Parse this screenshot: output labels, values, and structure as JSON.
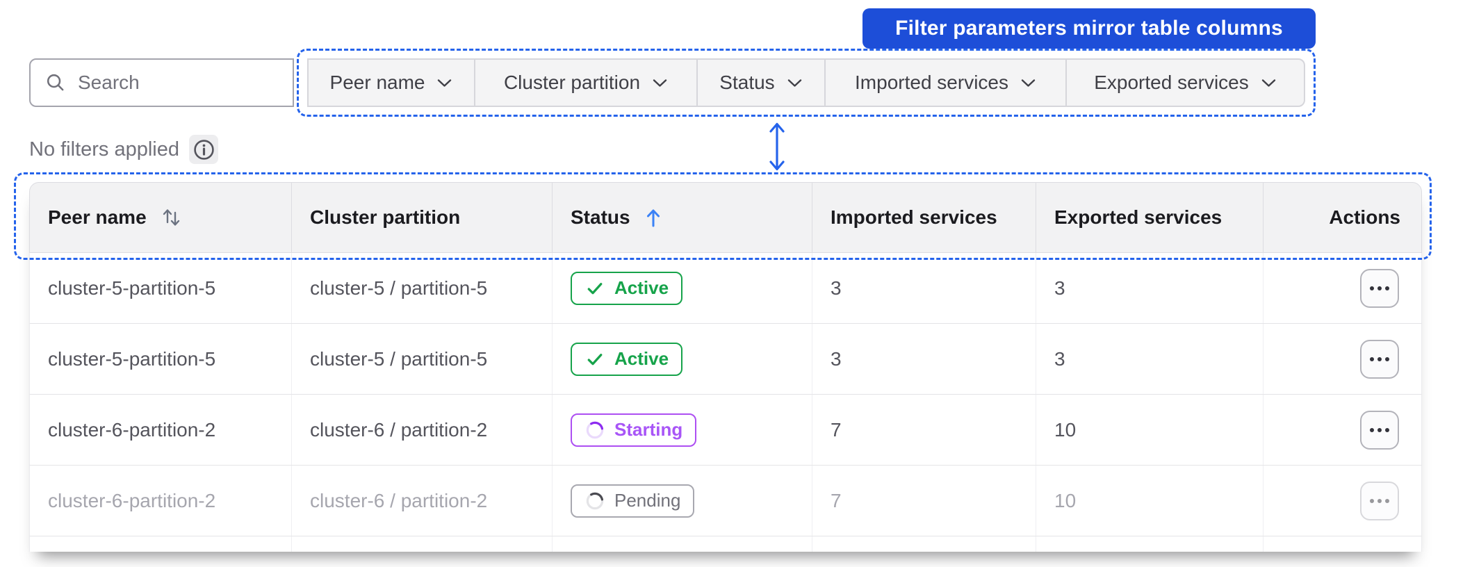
{
  "callout": {
    "label": "Filter parameters mirror table columns"
  },
  "search": {
    "placeholder": "Search"
  },
  "filter_bar": {
    "items": [
      {
        "label": "Peer name"
      },
      {
        "label": "Cluster partition"
      },
      {
        "label": "Status"
      },
      {
        "label": "Imported services"
      },
      {
        "label": "Exported services"
      }
    ]
  },
  "filters_status": {
    "label": "No filters applied"
  },
  "table": {
    "columns": [
      {
        "label": "Peer name",
        "sort": "unsorted"
      },
      {
        "label": "Cluster partition",
        "sort": "none"
      },
      {
        "label": "Status",
        "sort": "ascending"
      },
      {
        "label": "Imported services",
        "sort": "none"
      },
      {
        "label": "Exported services",
        "sort": "none"
      },
      {
        "label": "Actions",
        "sort": "none",
        "align": "right"
      }
    ],
    "rows": [
      {
        "peer_name": "cluster-5-partition-5",
        "cluster_partition": "cluster-5 / partition-5",
        "status": {
          "label": "Active",
          "kind": "active"
        },
        "imported_services": "3",
        "exported_services": "3",
        "disabled": false
      },
      {
        "peer_name": "cluster-5-partition-5",
        "cluster_partition": "cluster-5 / partition-5",
        "status": {
          "label": "Active",
          "kind": "active"
        },
        "imported_services": "3",
        "exported_services": "3",
        "disabled": false
      },
      {
        "peer_name": "cluster-6-partition-2",
        "cluster_partition": "cluster-6 / partition-2",
        "status": {
          "label": "Starting",
          "kind": "starting"
        },
        "imported_services": "7",
        "exported_services": "10",
        "disabled": false
      },
      {
        "peer_name": "cluster-6-partition-2",
        "cluster_partition": "cluster-6 / partition-2",
        "status": {
          "label": "Pending",
          "kind": "pending"
        },
        "imported_services": "7",
        "exported_services": "10",
        "disabled": true
      }
    ]
  },
  "colors": {
    "callout_blue": "#1d4ed8",
    "annotation_blue": "#2563eb",
    "active_green": "#16a34a",
    "starting_purple": "#a855f7",
    "pending_gray": "#71717a",
    "header_bg": "#f2f2f3",
    "filter_bar_bg": "#f4f4f5"
  }
}
